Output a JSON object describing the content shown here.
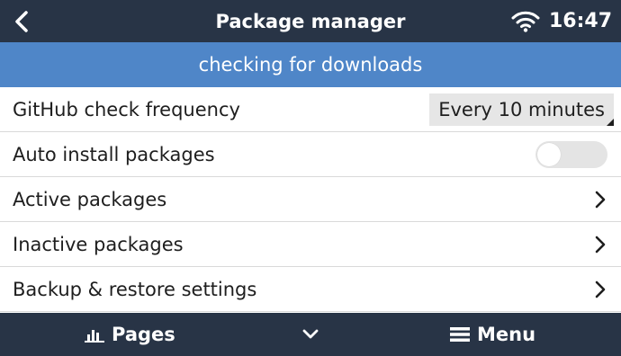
{
  "header": {
    "title": "Package manager",
    "time": "16:47",
    "back_icon": "chevron-left-icon",
    "wifi_icon": "wifi-icon"
  },
  "banner": {
    "text": "checking for downloads",
    "color": "#4f86c8"
  },
  "settings": {
    "github_check_frequency": {
      "label": "GitHub check frequency",
      "value": "Every 10 minutes"
    },
    "auto_install": {
      "label": "Auto install packages",
      "enabled": false
    },
    "active_packages": {
      "label": "Active packages"
    },
    "inactive_packages": {
      "label": "Inactive packages"
    },
    "backup_restore": {
      "label": "Backup & restore settings"
    }
  },
  "footer": {
    "pages_label": "Pages",
    "menu_label": "Menu"
  },
  "colors": {
    "bar_background": "#283446",
    "text": "#1e1e1e"
  }
}
